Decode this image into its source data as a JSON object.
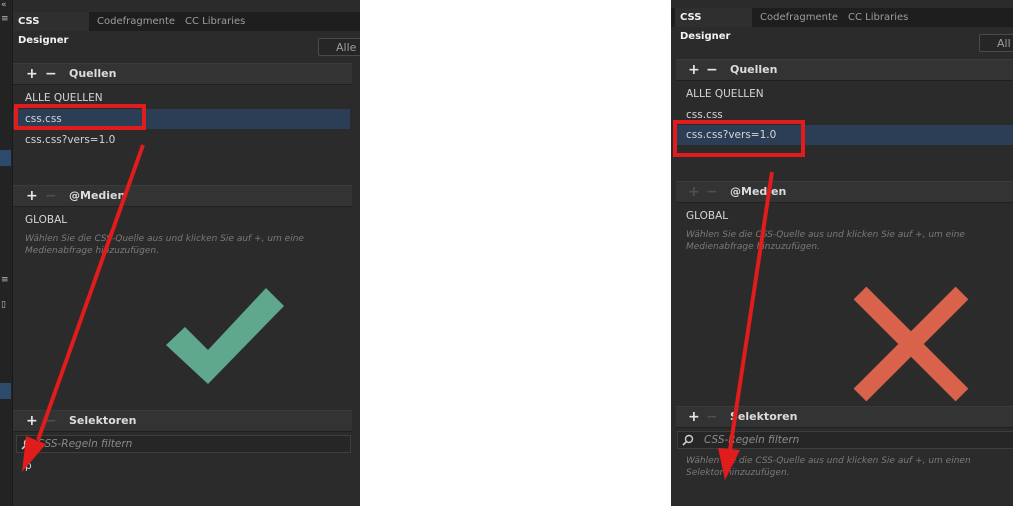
{
  "left": {
    "tabs": [
      "CSS Designer",
      "Codefragmente",
      "CC Libraries"
    ],
    "filter_label": "Alle",
    "sources_title": "Quellen",
    "sources": [
      "ALLE QUELLEN",
      "css.css",
      "css.css?vers=1.0"
    ],
    "media_title": "@Medien",
    "media_global": "GLOBAL",
    "media_hint": [
      "Wählen Sie die CSS-Quelle aus und klicken Sie auf +, um eine",
      "Medienabfrage hinzuzufügen."
    ],
    "selectors_title": "Selektoren",
    "filter_placeholder": "CSS-Regeln filtern",
    "selector_items": [
      "p"
    ],
    "result": "checkmark"
  },
  "right": {
    "tabs": [
      "CSS Designer",
      "Codefragmente",
      "CC Libraries"
    ],
    "filter_label": "All",
    "sources_title": "Quellen",
    "sources": [
      "ALLE QUELLEN",
      "css.css",
      "css.css?vers=1.0"
    ],
    "media_title": "@Medien",
    "media_global": "GLOBAL",
    "media_hint": [
      "Wählen Sie die CSS-Quelle aus und klicken Sie auf +, um eine",
      "Medienabfrage hinzuzufügen."
    ],
    "selectors_title": "Selektoren",
    "filter_placeholder": "CSS-Regeln filtern",
    "selectors_hint": [
      "Wählen Sie die CSS-Quelle aus und klicken Sie auf +, um einen",
      "Selektor hinzuzufügen."
    ],
    "result": "cross"
  },
  "colors": {
    "highlight_box": "#e01c1c",
    "arrow": "#e01c1c",
    "check": "#5fa88e",
    "cross": "#d9634a",
    "selected_row": "#2b3e55"
  }
}
